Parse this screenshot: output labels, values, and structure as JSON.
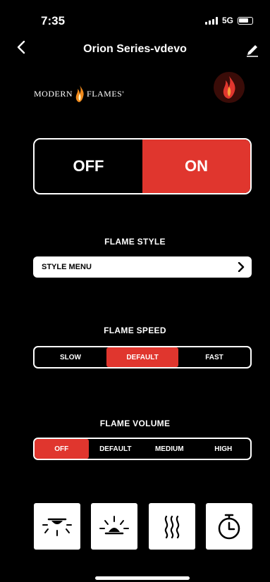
{
  "status": {
    "time": "7:35",
    "network": "5G"
  },
  "nav": {
    "title": "Orion Series-vdevo"
  },
  "brand": {
    "left": "MODERN",
    "right": "FLAMES",
    "mark": "'"
  },
  "power": {
    "off_label": "OFF",
    "on_label": "ON",
    "state": "ON"
  },
  "flame_style": {
    "title": "FLAME STYLE",
    "menu_label": "STYLE MENU"
  },
  "flame_speed": {
    "title": "FLAME SPEED",
    "options": [
      "SLOW",
      "DEFAULT",
      "FAST"
    ],
    "selected": "DEFAULT"
  },
  "flame_volume": {
    "title": "FLAME VOLUME",
    "options": [
      "OFF",
      "DEFAULT",
      "MEDIUM",
      "HIGH"
    ],
    "selected": "OFF"
  },
  "colors": {
    "accent": "#e0362e",
    "background": "#000000",
    "flame_orange": "#f08a1c"
  },
  "mode_buttons": [
    "downlight-icon",
    "uplight-icon",
    "heat-icon",
    "timer-icon"
  ]
}
